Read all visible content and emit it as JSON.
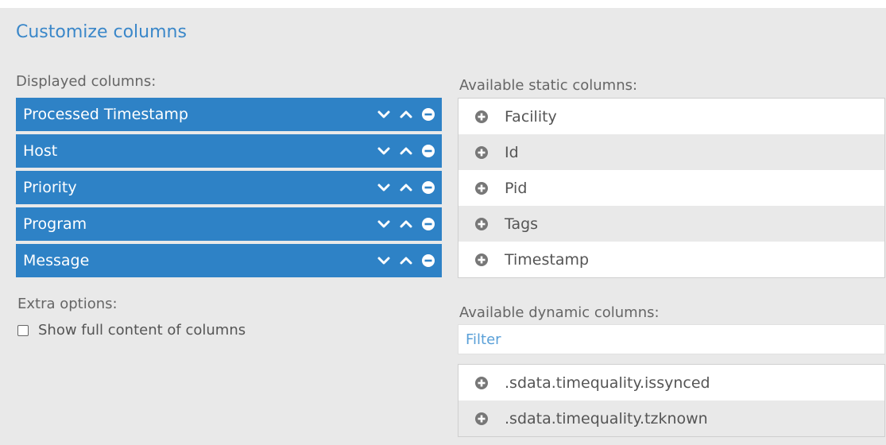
{
  "title": "Customize columns",
  "displayed": {
    "label": "Displayed columns:",
    "items": [
      {
        "label": "Processed Timestamp"
      },
      {
        "label": "Host"
      },
      {
        "label": "Priority"
      },
      {
        "label": "Program"
      },
      {
        "label": "Message"
      }
    ]
  },
  "extra": {
    "label": "Extra options:",
    "checkbox_label": "Show full content of columns",
    "checked": false
  },
  "static": {
    "label": "Available static columns:",
    "items": [
      "Facility",
      "Id",
      "Pid",
      "Tags",
      "Timestamp"
    ]
  },
  "dynamic": {
    "label": "Available dynamic columns:",
    "filter_placeholder": "Filter",
    "items": [
      ".sdata.timequality.issynced",
      ".sdata.timequality.tzknown"
    ]
  },
  "colors": {
    "accent": "#2e82c6",
    "title": "#3a87c9",
    "panel_bg": "#e9e9e9",
    "icon_gray": "#777777"
  },
  "icons": {
    "move_down": "chevron-down-icon",
    "move_up": "chevron-up-icon",
    "remove": "minus-circle-icon",
    "add": "plus-circle-icon"
  }
}
